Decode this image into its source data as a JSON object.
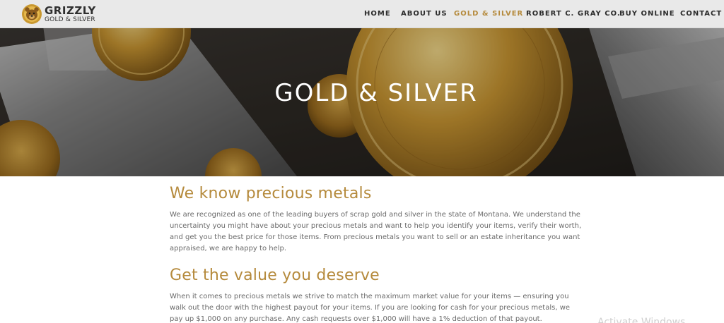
{
  "logo": {
    "name_line1": "GRIZZLY",
    "name_line2": "GOLD & SILVER",
    "icon": "bear-badge-icon"
  },
  "nav": {
    "items": [
      {
        "label": "HOME"
      },
      {
        "label": "ABOUT US"
      },
      {
        "label": "GOLD & SILVER"
      },
      {
        "label": "ROBERT C. GRAY CO."
      },
      {
        "label": "BUY ONLINE"
      },
      {
        "label": "CONTACT U"
      }
    ],
    "active": "GOLD & SILVER"
  },
  "hero": {
    "title": "GOLD & SILVER"
  },
  "main": {
    "section1": {
      "heading": "We know precious metals",
      "body": "We are recognized as one of the leading buyers of scrap gold and silver in the state of Montana. We understand the uncertainty you might have about your precious metals and want to help you identify your items, verify their worth, and get you the best price for those items. From precious metals you want to sell or an estate inheritance you want appraised, we are happy to help."
    },
    "section2": {
      "heading": "Get the value you deserve",
      "body": "When it comes to precious metals we strive to match the maximum market value for your items — ensuring you walk out the door with the highest payout for your items. If you are looking for cash for your precious metals, we pay up $1,000 on any purchase. Any cash requests over $1,000 will have a 1% deduction of that payout."
    }
  },
  "overlay": {
    "activate_text": "Activate Windows"
  },
  "colors": {
    "accent": "#b58a3c",
    "header_bg": "#e9e9e9",
    "body_text": "#6a6a6a"
  }
}
